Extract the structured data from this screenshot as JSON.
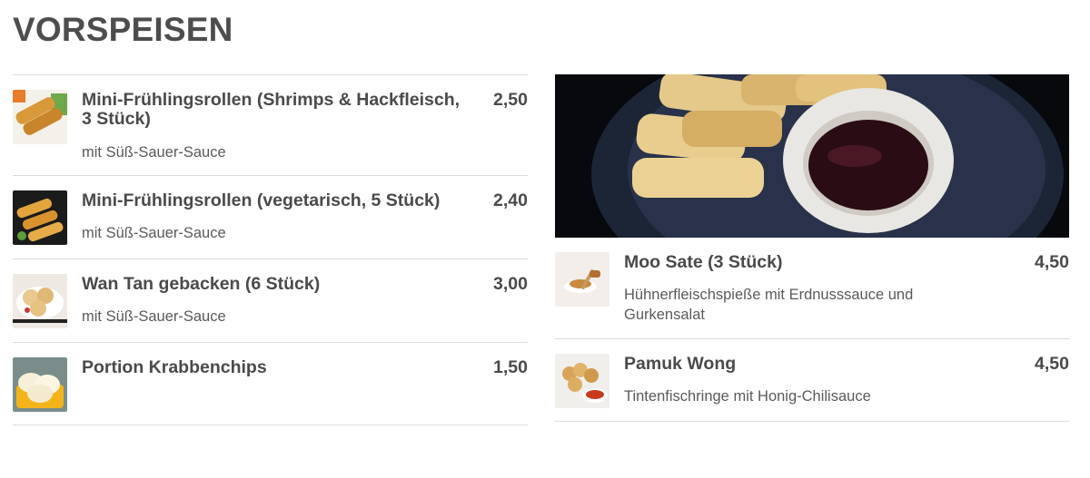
{
  "section": {
    "title": "VORSPEISEN"
  },
  "left_items": [
    {
      "name": "Mini-Frühlingsrollen (Shrimps & Hackfleisch, 3 Stück)",
      "price": "2,50",
      "description": "mit Süß-Sauer-Sauce",
      "image_icon": "spring-rolls-photo"
    },
    {
      "name": "Mini-Frühlingsrollen (vegetarisch, 5 Stück)",
      "price": "2,40",
      "description": "mit Süß-Sauer-Sauce",
      "image_icon": "veg-spring-rolls-photo"
    },
    {
      "name": "Wan Tan gebacken (6 Stück)",
      "price": "3,00",
      "description": "mit Süß-Sauer-Sauce",
      "image_icon": "wan-tan-photo"
    },
    {
      "name": "Portion Krabbenchips",
      "price": "1,50",
      "description": "",
      "image_icon": "prawn-crackers-photo"
    }
  ],
  "right_items": [
    {
      "name": "Moo Sate (3 Stück)",
      "price": "4,50",
      "description": "Hühnerfleischspieße mit Erdnusssauce und Gurkensalat",
      "image_icon": "moo-sate-photo"
    },
    {
      "name": "Pamuk Wong",
      "price": "4,50",
      "description": "Tintenfischringe mit Honig-Chilisauce",
      "image_icon": "pamuk-wong-photo"
    }
  ],
  "hero_image": {
    "icon": "spring-rolls-dip-photo"
  },
  "colors": {
    "text": "#4a4a4a",
    "divider": "#dcdcdc",
    "hero_bg": "#07090d"
  }
}
